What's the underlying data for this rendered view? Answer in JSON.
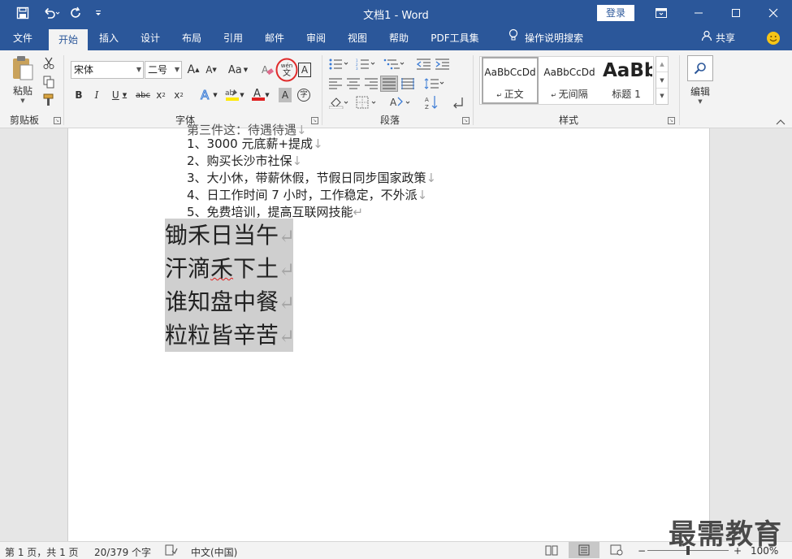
{
  "titlebar": {
    "title": "文档1  -  Word",
    "login_label": "登录"
  },
  "tabs": [
    "文件",
    "开始",
    "插入",
    "设计",
    "布局",
    "引用",
    "邮件",
    "审阅",
    "视图",
    "帮助",
    "PDF工具集",
    "操作说明搜索"
  ],
  "tabs_right": {
    "share": "共享"
  },
  "ribbon": {
    "clipboard": {
      "paste_label": "粘贴",
      "group_label": "剪贴板"
    },
    "font": {
      "font_name": "宋体",
      "font_size": "二号",
      "group_label": "字体",
      "grow": "A",
      "shrink": "A",
      "case": "Aa",
      "phonetic_top": "wén",
      "phonetic_bottom": "文",
      "border_char": "A",
      "bold": "B",
      "italic": "I",
      "underline": "U",
      "strike": "abc",
      "subscript": "x",
      "superscript": "x",
      "shading_char": "A",
      "enclose": "字"
    },
    "paragraph": {
      "group_label": "段落"
    },
    "styles": {
      "group_label": "样式",
      "items": [
        {
          "sample": "AaBbCcDd",
          "name": "正文"
        },
        {
          "sample": "AaBbCcDd",
          "name": "无间隔"
        },
        {
          "sample": "AaBb",
          "name": "标题 1"
        }
      ]
    },
    "editing": {
      "label": "编辑"
    }
  },
  "document": {
    "partial_top": "第三件这：待遇待遇",
    "list_lines": [
      "1、3000 元底薪+提成",
      "2、购买长沙市社保",
      "3、大小休，带薪休假，节假日同步国家政策",
      "4、日工作时间 7 小时，工作稳定，不外派",
      "5、免费培训，提高互联网技能"
    ],
    "poem_lines": [
      "锄禾日当午",
      "汗滴禾下土",
      "谁知盘中餐",
      "粒粒皆辛苦"
    ],
    "line_break_mark": "↓",
    "paragraph_mark": "↵"
  },
  "statusbar": {
    "page": "第 1 页，共 1 页",
    "words": "20/379 个字",
    "language": "中文(中国)",
    "zoom": "100%",
    "minus": "−",
    "plus": "+"
  },
  "watermark": "最需教育",
  "colors": {
    "brand_blue": "#2b579a",
    "highlight_circle": "#e02a2a",
    "selection": "#cfcfcf",
    "font_color_red": "#e02020",
    "highlighter_yellow": "#ffe800"
  }
}
